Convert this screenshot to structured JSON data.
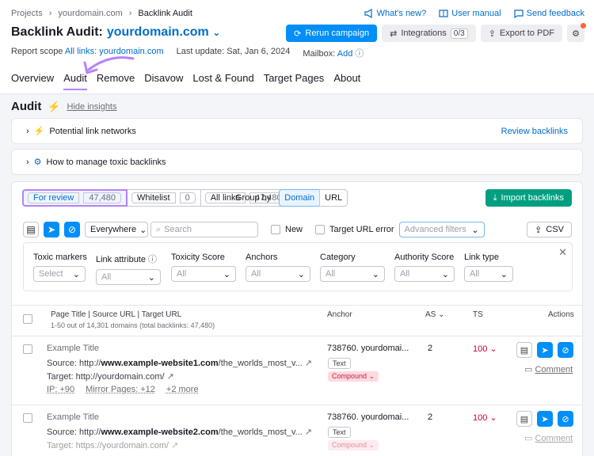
{
  "breadcrumb": [
    "Projects",
    "yourdomain.com",
    "Backlink Audit"
  ],
  "top_links": {
    "whats_new": "What's new?",
    "user_manual": "User manual",
    "feedback": "Send feedback"
  },
  "title": {
    "prefix": "Backlink Audit:",
    "domain": "yourdomain.com"
  },
  "buttons": {
    "rerun": "Rerun campaign",
    "integrations": "Integrations",
    "integrations_badge": "0/3",
    "export": "Export to PDF"
  },
  "scope": {
    "label": "Report scope",
    "value": "All links: yourdomain.com",
    "last_update": "Last update: Sat, Jan 6, 2024",
    "mailbox_label": "Mailbox:",
    "mailbox_action": "Add"
  },
  "tabs": [
    "Overview",
    "Audit",
    "Remove",
    "Disavow",
    "Lost & Found",
    "Target Pages",
    "About"
  ],
  "active_tab": "Audit",
  "audit": {
    "heading": "Audit",
    "hide_insights": "Hide insights"
  },
  "insights": [
    {
      "label": "Potential link networks",
      "action": "Review backlinks"
    },
    {
      "label": "How to manage toxic backlinks"
    }
  ],
  "segments": [
    {
      "label": "For review",
      "count": "47,480"
    },
    {
      "label": "Whitelist",
      "count": "0"
    },
    {
      "label": "All links",
      "count": "47,480"
    }
  ],
  "group_by": {
    "label": "Group by",
    "options": [
      "Domain",
      "URL"
    ],
    "selected": "Domain"
  },
  "import_label": "Import backlinks",
  "filters": {
    "scope": "Everywhere",
    "search_placeholder": "Search",
    "new": "New",
    "target_error": "Target URL error",
    "advanced": "Advanced filters",
    "csv": "CSV"
  },
  "filter_panel": [
    {
      "label": "Toxic markers",
      "value": "Select"
    },
    {
      "label": "Link attribute",
      "value": "All"
    },
    {
      "label": "Toxicity Score",
      "value": "All"
    },
    {
      "label": "Anchors",
      "value": "All"
    },
    {
      "label": "Category",
      "value": "All"
    },
    {
      "label": "Authority Score",
      "value": "All"
    },
    {
      "label": "Link type",
      "value": "All"
    }
  ],
  "table": {
    "col_title": "Page Title | Source URL | Target URL",
    "summary": "1-50 out of 14,301 domains (total backlinks: 47,480)",
    "col_anchor": "Anchor",
    "col_as": "AS",
    "col_ts": "TS",
    "col_actions": "Actions",
    "rows": [
      {
        "title": "Example Title",
        "source_prefix": "Source: http://",
        "source_domain": "www.example-website1.com",
        "source_path": "/the_worlds_most_v...",
        "target": "Target: http://yourdomain.com/",
        "ip": "IP: +90",
        "mirror": "Mirror Pages: +12",
        "more": "+2 more",
        "anchor": "738760. yourdomai...",
        "anchor_type": "Text",
        "anchor_tag": "Compound",
        "as": "2",
        "ts": "100",
        "comment": "Comment"
      },
      {
        "title": "Example Title",
        "source_prefix": "Source: http://",
        "source_domain": "www.example-website2.com",
        "source_path": "/the_worlds_most_v...",
        "target": "Target: https://yourdomain.com/",
        "anchor": "738760. yourdomai...",
        "anchor_type": "Text",
        "anchor_tag": "Compound",
        "as": "2",
        "ts": "100",
        "comment": "Comment"
      }
    ]
  },
  "colors": {
    "accent": "#008ff8",
    "import": "#009f81",
    "highlight": "#b382ff",
    "danger": "#d1002f"
  }
}
